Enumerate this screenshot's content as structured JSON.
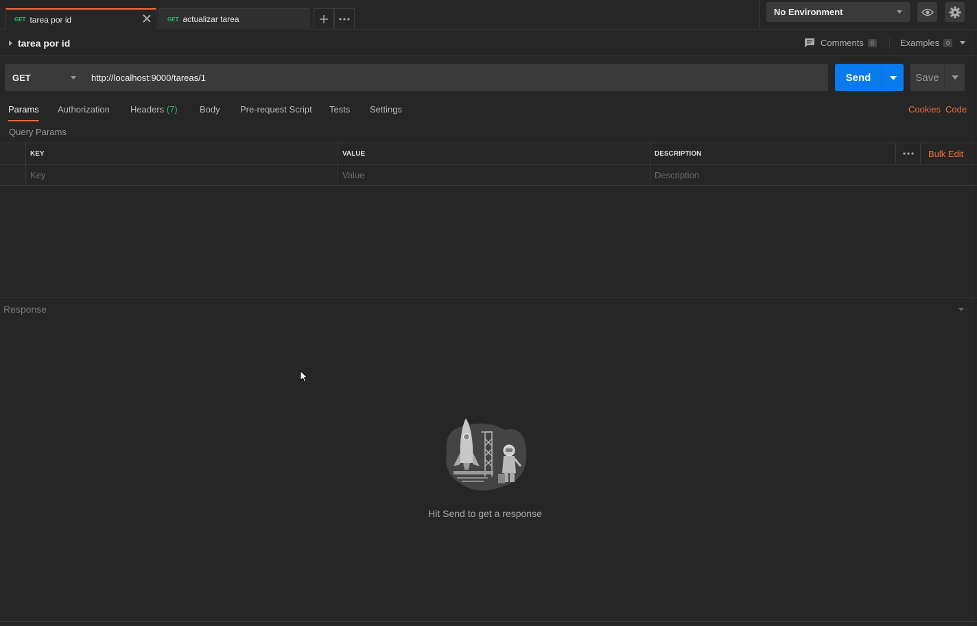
{
  "tabs": [
    {
      "method": "GET",
      "name": "tarea por id",
      "active": true
    },
    {
      "method": "GET",
      "name": "actualizar tarea",
      "active": false
    }
  ],
  "environment": {
    "selected": "No Environment"
  },
  "request": {
    "title": "tarea por id",
    "comments_label": "Comments",
    "comments_count": "0",
    "examples_label": "Examples",
    "examples_count": "0",
    "method": "GET",
    "url": "http://localhost:9000/tareas/1",
    "send_label": "Send",
    "save_label": "Save"
  },
  "subtabs": {
    "params": "Params",
    "authorization": "Authorization",
    "headers": "Headers",
    "headers_count": "(7)",
    "body": "Body",
    "prerequest": "Pre-request Script",
    "tests": "Tests",
    "settings": "Settings",
    "cookies": "Cookies",
    "code": "Code"
  },
  "params": {
    "section_label": "Query Params",
    "headers": {
      "key": "KEY",
      "value": "VALUE",
      "description": "DESCRIPTION"
    },
    "bulk_edit": "Bulk Edit",
    "placeholders": {
      "key": "Key",
      "value": "Value",
      "description": "Description"
    }
  },
  "response": {
    "label": "Response",
    "empty_message": "Hit Send to get a response"
  },
  "colors": {
    "accent": "#f26b3a",
    "send": "#097bed",
    "method_green": "#2fb672"
  }
}
